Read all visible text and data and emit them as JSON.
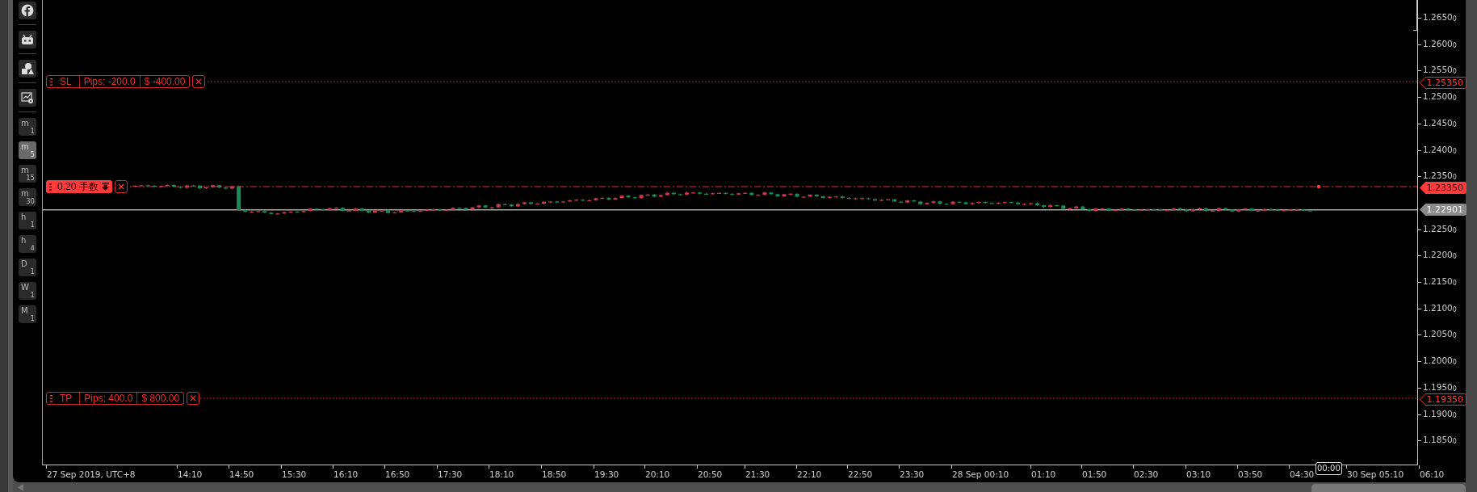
{
  "timeframes": [
    {
      "unit": "m",
      "count": "1",
      "selected": false
    },
    {
      "unit": "m",
      "count": "5",
      "selected": true
    },
    {
      "unit": "m",
      "count": "15",
      "selected": false
    },
    {
      "unit": "m",
      "count": "30",
      "selected": false
    },
    {
      "unit": "h",
      "count": "1",
      "selected": false
    },
    {
      "unit": "h",
      "count": "4",
      "selected": false
    },
    {
      "unit": "D",
      "count": "1",
      "selected": false
    },
    {
      "unit": "W",
      "count": "1",
      "selected": false
    },
    {
      "unit": "M",
      "count": "1",
      "selected": false
    }
  ],
  "orders": [
    {
      "kind": "stop_loss",
      "tag": "SL",
      "pips": "Pips: -200.0",
      "amount": "$ -400.00",
      "price": "1.25350"
    },
    {
      "kind": "position",
      "lots": "0.20 手数",
      "price": "1.23350"
    },
    {
      "kind": "take_profit",
      "tag": "TP",
      "pips": "Pips: 400.0",
      "amount": "$ 800.00",
      "price": "1.19350"
    }
  ],
  "current_price": "1.22901",
  "price_axis": [
    "1.2650$_{0}$",
    "1.2600$_{0}$",
    "1.2550$_{0}$",
    "1.2500$_{0}$",
    "1.2450$_{0}$",
    "1.2400$_{0}$",
    "1.2350$_{0}$",
    "1.2250$_{0}$",
    "1.2200$_{0}$",
    "1.2150$_{0}$",
    "1.2100$_{0}$",
    "1.2050$_{0}$",
    "1.2000$_{0}$",
    "1.1950$_{0}$",
    "1.1900$_{0}$",
    "1.1850$_{0}$"
  ],
  "time_axis": [
    "27 Sep 2019, UTC+8",
    "14:10",
    "14:50",
    "15:30",
    "16:10",
    "16:50",
    "17:30",
    "18:10",
    "18:50",
    "19:30",
    "20:10",
    "20:50",
    "21:30",
    "22:10",
    "22:50",
    "23:30",
    "28 Sep 00:10",
    "01:10",
    "01:50",
    "02:30",
    "03:10",
    "03:50",
    "04:30",
    "30 Sep 05:10",
    "06:10"
  ],
  "crosshair_time": "00:00"
}
